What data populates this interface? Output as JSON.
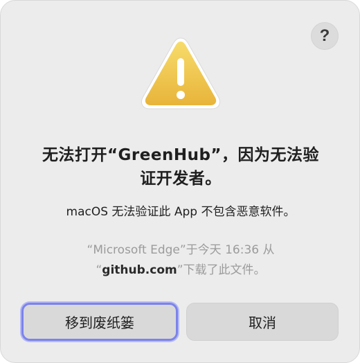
{
  "dialog": {
    "help_label": "?",
    "icon": "warning-triangle-icon",
    "title_line1": "无法打开“GreenHub”，因为无法验",
    "title_line2": "证开发者。",
    "subtitle": "macOS 无法验证此 App 不包含恶意软件。",
    "source_line1": "“Microsoft Edge”于今天 16:36 从",
    "source_quote_open": "“",
    "source_host": "github.com",
    "source_line2_rest": "”下载了此文件。",
    "buttons": {
      "trash": "移到废纸篓",
      "cancel": "取消"
    }
  },
  "colors": {
    "dialog_background": "#ececec",
    "warning_yellow": "#f2c84b",
    "focus_ring": "#7c83e9",
    "button_background": "#d9d9d9"
  }
}
